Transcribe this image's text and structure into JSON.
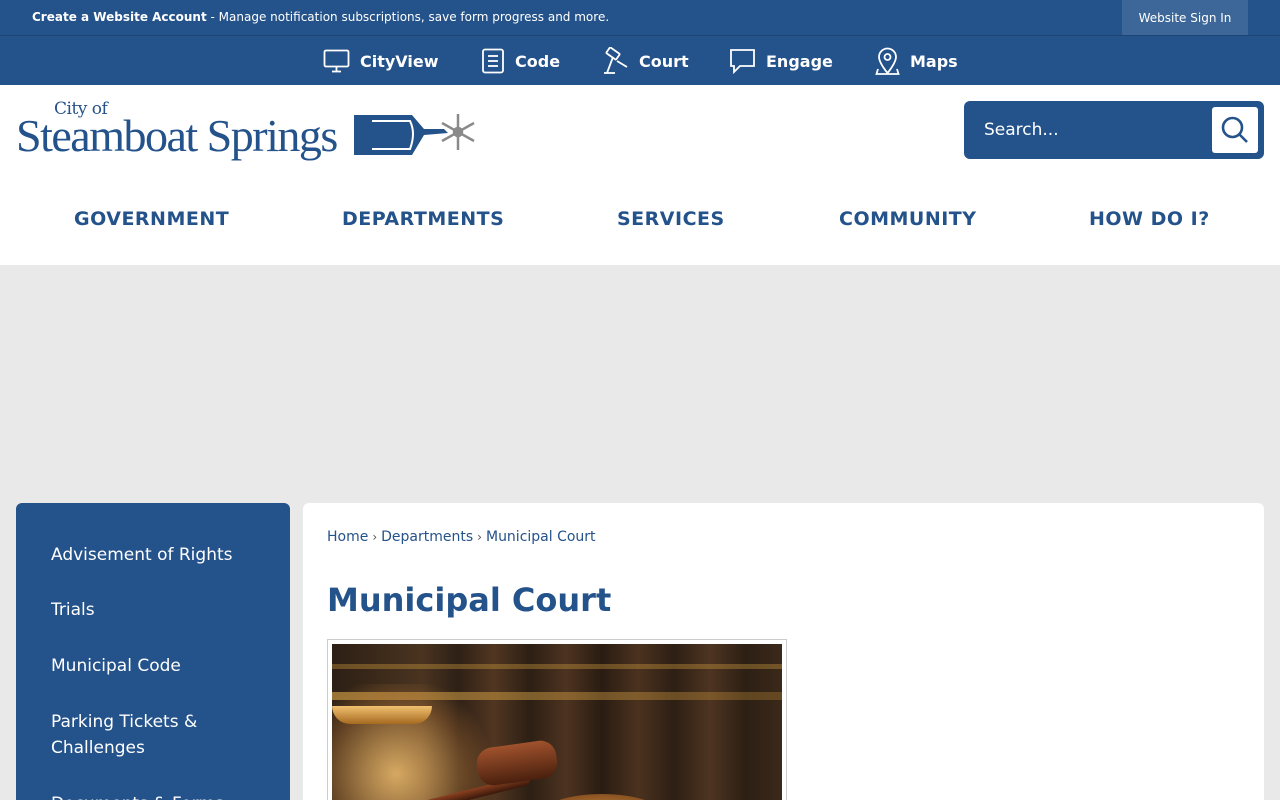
{
  "topbar": {
    "account_link": "Create a Website Account",
    "account_desc": " - Manage notification subscriptions, save form progress and more.",
    "signin": "Website Sign In"
  },
  "quicklinks": [
    {
      "label": "CityView",
      "icon": "monitor-icon"
    },
    {
      "label": "Code",
      "icon": "document-icon"
    },
    {
      "label": "Court",
      "icon": "gavel-icon"
    },
    {
      "label": "Engage",
      "icon": "chat-bubble-icon"
    },
    {
      "label": "Maps",
      "icon": "map-pin-icon"
    }
  ],
  "logo": {
    "city_of": "City of",
    "name": "Steamboat Springs"
  },
  "search": {
    "placeholder": "Search..."
  },
  "mainnav": [
    "GOVERNMENT",
    "DEPARTMENTS",
    "SERVICES",
    "COMMUNITY",
    "HOW DO I?"
  ],
  "sidebar": [
    "Advisement of Rights",
    "Trials",
    "Municipal Code",
    "Parking Tickets & Challenges",
    "Documents & Forms"
  ],
  "breadcrumb": [
    "Home",
    "Departments",
    "Municipal Court"
  ],
  "page_title": "Municipal Court",
  "colors": {
    "brand": "#24528a",
    "background": "#e9e9e9",
    "white": "#ffffff"
  }
}
